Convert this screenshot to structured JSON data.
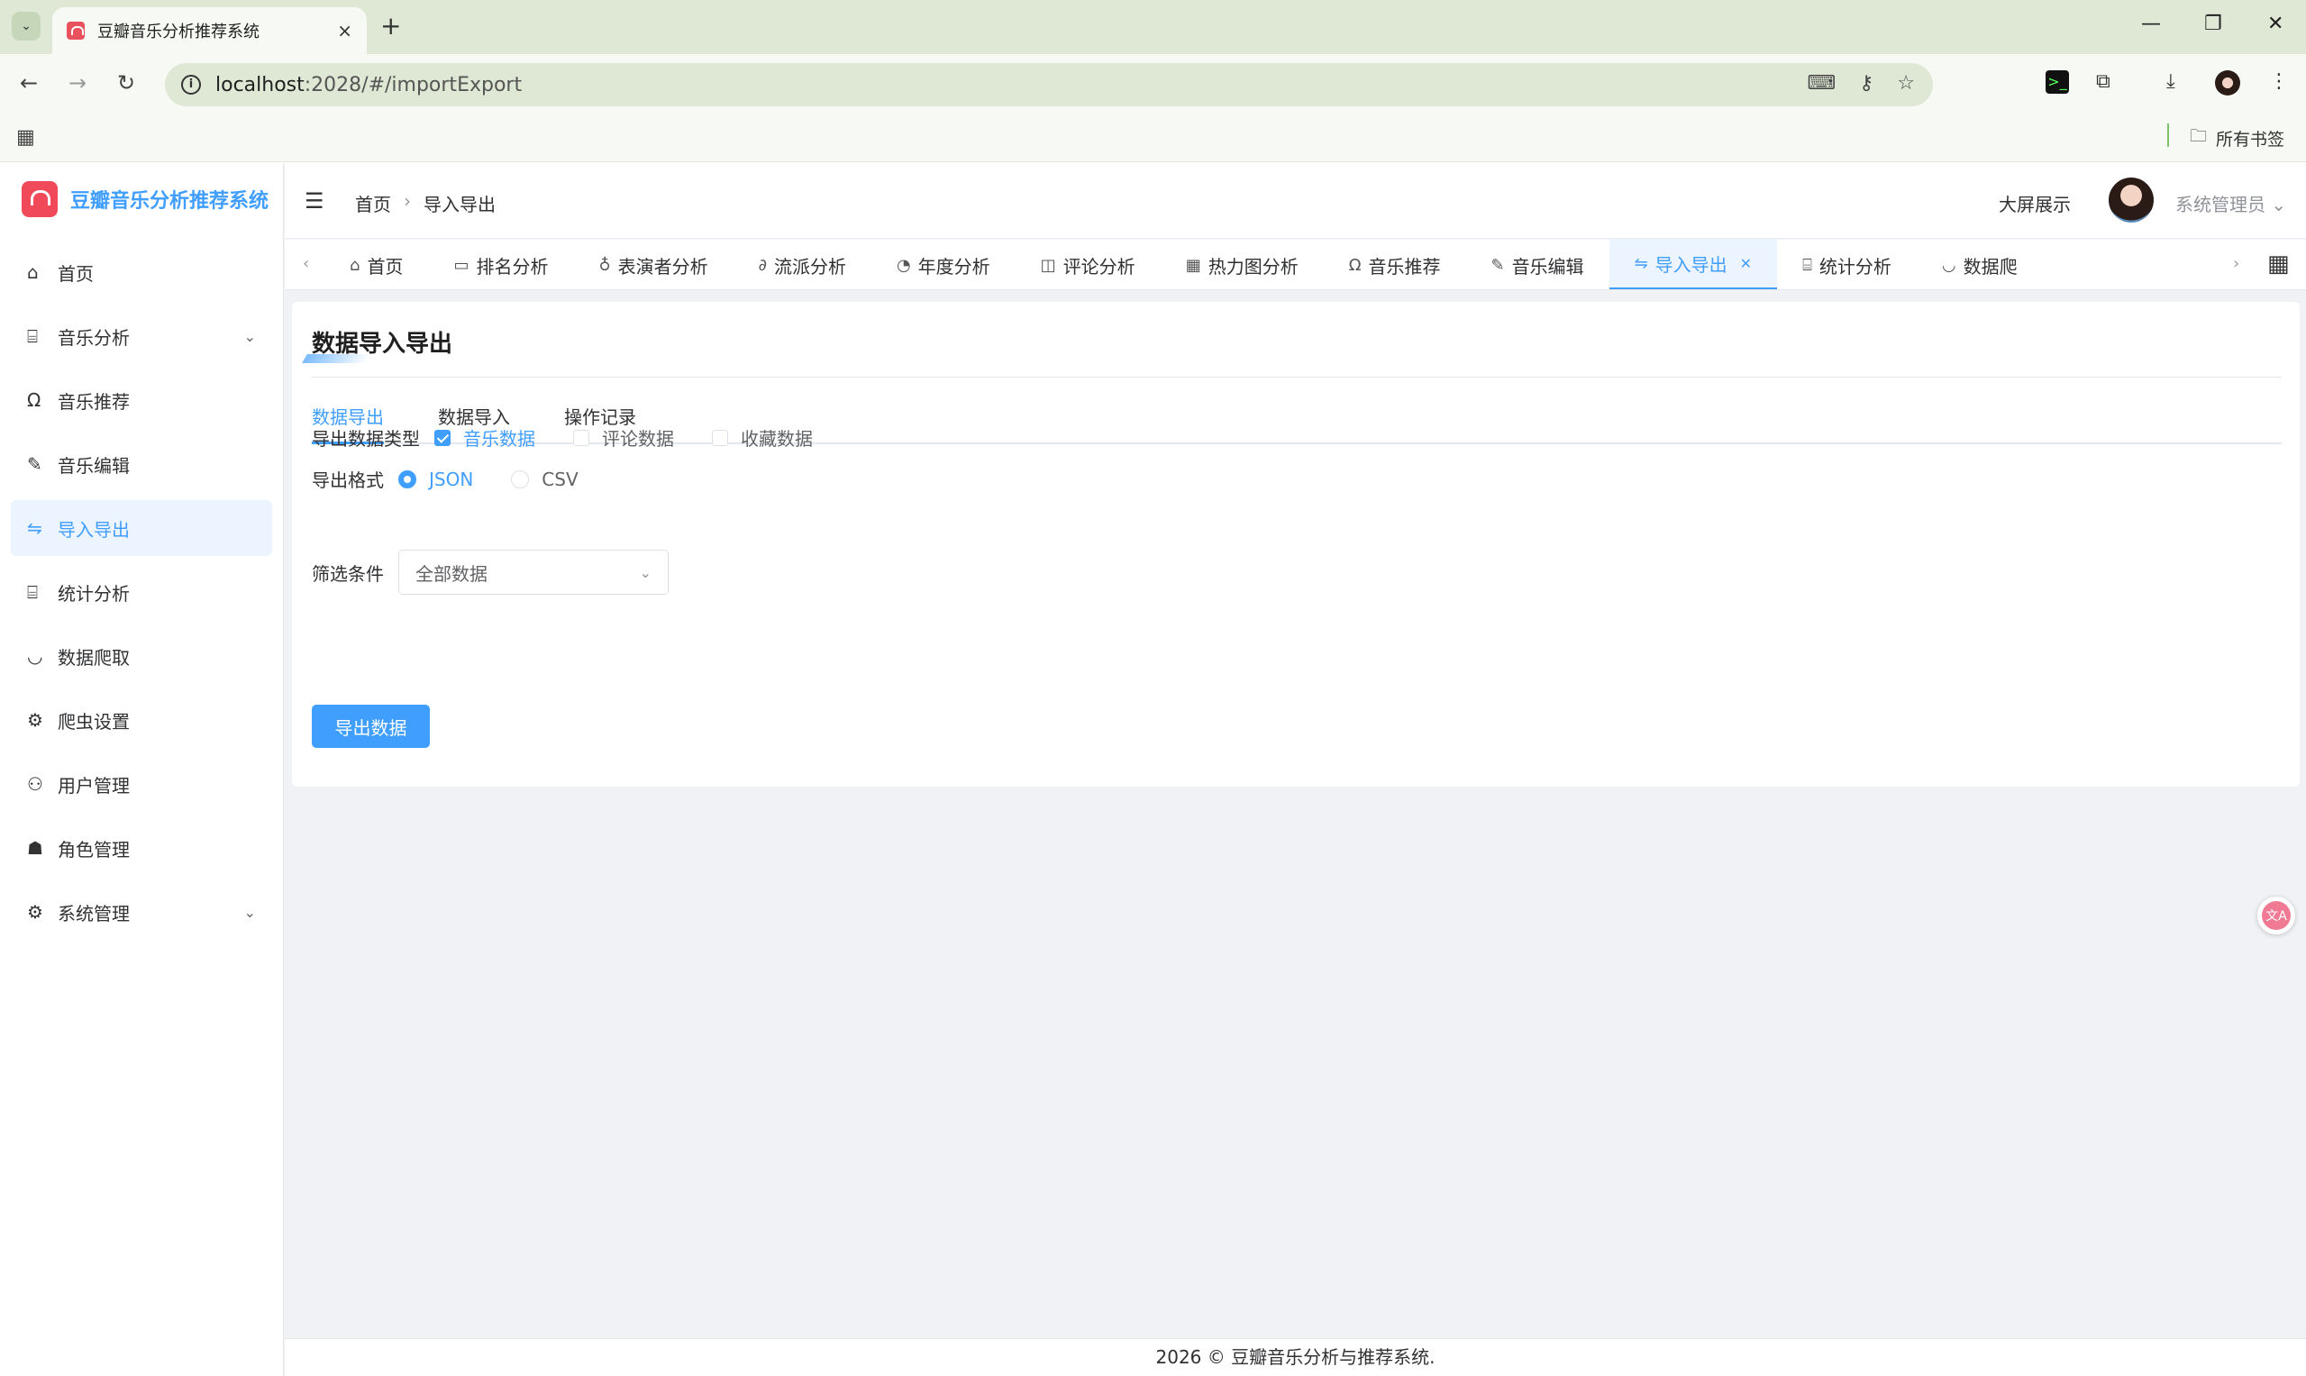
{
  "browser": {
    "tab_title": "豆瓣音乐分析推荐系统",
    "tab_close": "×",
    "new_tab": "+",
    "url_host": "localhost",
    "url_rest": ":2028/#/importExport",
    "all_bookmarks": "所有书签",
    "minimize": "—",
    "restore": "❐",
    "close": "✕"
  },
  "sidebar": {
    "title": "豆瓣音乐分析推荐系统",
    "items": [
      {
        "label": "首页",
        "icon": "home-icon"
      },
      {
        "label": "音乐分析",
        "icon": "chart-board-icon",
        "expandable": true
      },
      {
        "label": "音乐推荐",
        "icon": "headphones-icon"
      },
      {
        "label": "音乐编辑",
        "icon": "edit-pen-icon"
      },
      {
        "label": "导入导出",
        "icon": "switch-arrows-icon",
        "active": true
      },
      {
        "label": "统计分析",
        "icon": "chart-board-icon"
      },
      {
        "label": "数据爬取",
        "icon": "bowl-icon"
      },
      {
        "label": "爬虫设置",
        "icon": "gear-icon"
      },
      {
        "label": "用户管理",
        "icon": "user-icon"
      },
      {
        "label": "角色管理",
        "icon": "user-filled-icon"
      },
      {
        "label": "系统管理",
        "icon": "gear-icon",
        "expandable": true
      }
    ]
  },
  "header": {
    "breadcrumb_home": "首页",
    "breadcrumb_current": "导入导出",
    "big_screen": "大屏展示",
    "user_name": "系统管理员"
  },
  "tags": [
    {
      "label": "首页",
      "icon": "home-icon"
    },
    {
      "label": "排名分析",
      "icon": "folder-icon"
    },
    {
      "label": "表演者分析",
      "icon": "bulb-icon"
    },
    {
      "label": "流派分析",
      "icon": "paperclip-icon"
    },
    {
      "label": "年度分析",
      "icon": "compass-icon"
    },
    {
      "label": "评论分析",
      "icon": "book-icon"
    },
    {
      "label": "热力图分析",
      "icon": "grid-icon"
    },
    {
      "label": "音乐推荐",
      "icon": "headphones-icon"
    },
    {
      "label": "音乐编辑",
      "icon": "edit-pen-icon"
    },
    {
      "label": "导入导出",
      "icon": "switch-arrows-icon",
      "active": true
    },
    {
      "label": "统计分析",
      "icon": "chart-board-icon"
    },
    {
      "label": "数据爬",
      "icon": "bowl-icon"
    }
  ],
  "main": {
    "title": "数据导入导出",
    "tabs": [
      "数据导出",
      "数据导入",
      "操作记录"
    ],
    "type_label": "导出数据类型",
    "types": [
      {
        "label": "音乐数据",
        "checked": true
      },
      {
        "label": "评论数据",
        "checked": false
      },
      {
        "label": "收藏数据",
        "checked": false
      }
    ],
    "format_label": "导出格式",
    "formats": [
      {
        "label": "JSON",
        "selected": true
      },
      {
        "label": "CSV",
        "selected": false
      }
    ],
    "filter_label": "筛选条件",
    "filter_value": "全部数据",
    "export_button": "导出数据"
  },
  "footer": {
    "text": "2026 © 豆瓣音乐分析与推荐系统."
  },
  "colors": {
    "primary": "#409eff",
    "logo_red": "#f04a5a"
  }
}
